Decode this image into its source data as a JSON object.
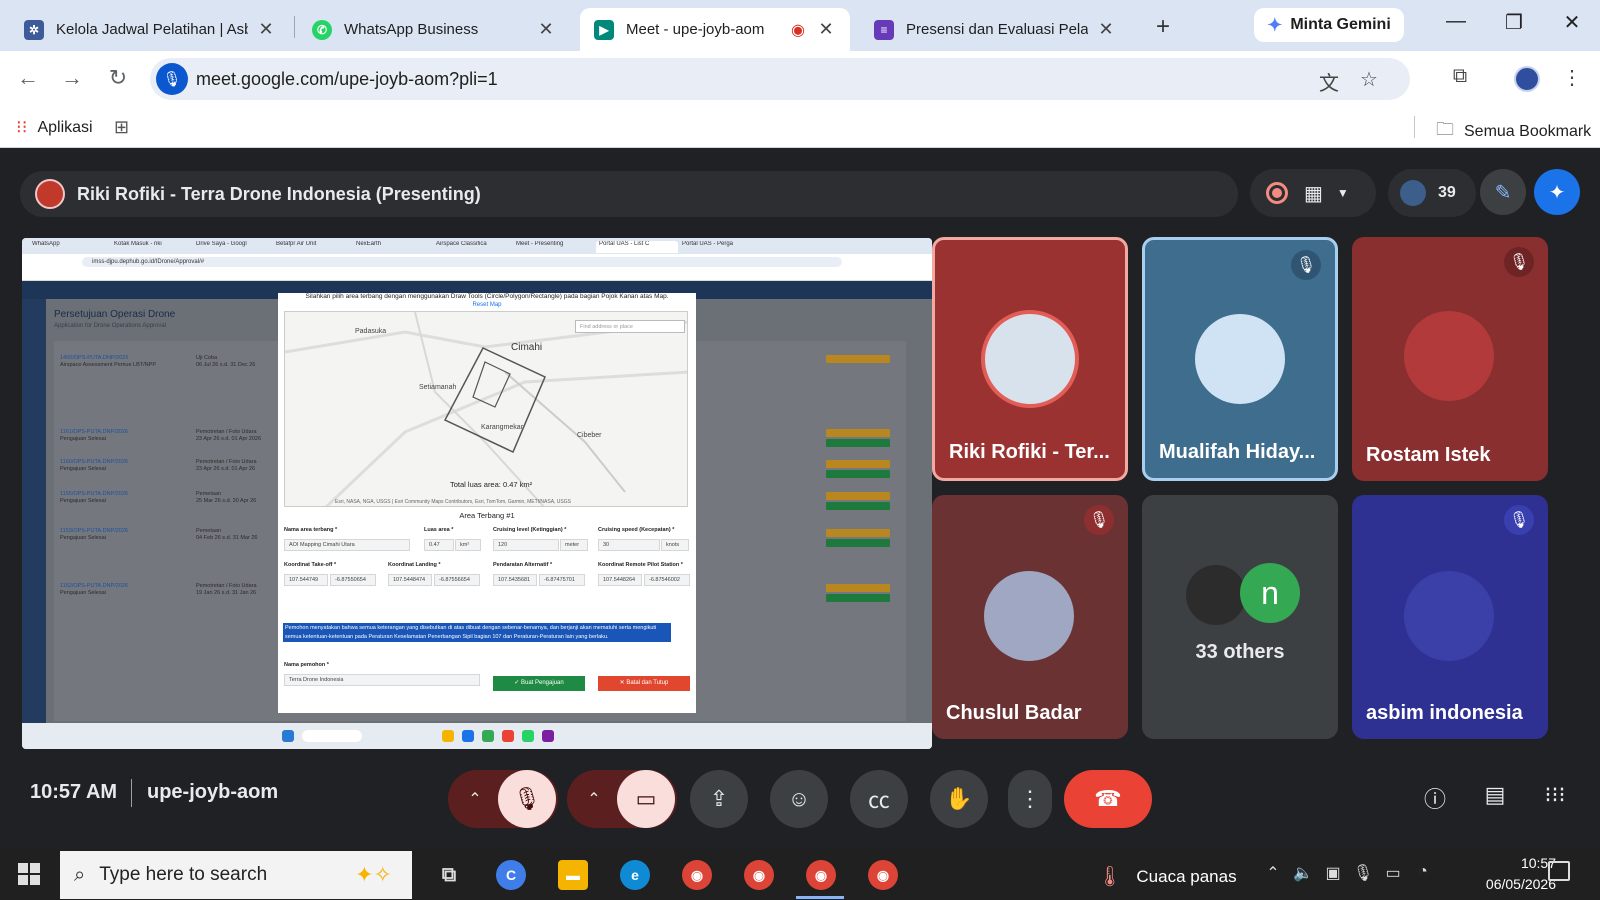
{
  "browser": {
    "tabs": [
      {
        "label": "Kelola Jadwal Pelatihan | Asbi",
        "icon": "asbim-icon",
        "color": "#3d5a99"
      },
      {
        "label": "WhatsApp Business",
        "icon": "whatsapp-icon",
        "color": "#25d366"
      },
      {
        "label": "Meet - upe-joyb-aom",
        "icon": "meet-icon",
        "color": "#00897b",
        "active": true
      },
      {
        "label": "Presensi dan Evaluasi Pelatiha",
        "icon": "forms-icon",
        "color": "#673ab7"
      }
    ],
    "gemini_label": "Minta Gemini",
    "url": "meet.google.com/upe-joyb-aom?pli=1",
    "bookmarks": {
      "apps": "Aplikasi",
      "all": "Semua Bookmark"
    }
  },
  "meet": {
    "presenter_label": "Riki Rofiki - Terra Drone Indonesia (Presenting)",
    "participant_count": "39",
    "participants": [
      {
        "name": "Riki Rofiki - Ter...",
        "muted": false,
        "bg": "#9b3232"
      },
      {
        "name": "Mualifah Hiday...",
        "muted": true,
        "bg": "#3f6d8e"
      },
      {
        "name": "Rostam Istek",
        "muted": true,
        "bg": "#8a2f2f"
      },
      {
        "name": "Chuslul Badar",
        "muted": true,
        "bg": "#6b3234"
      },
      {
        "name": "33 others",
        "muted": false,
        "bg": "#3c4043"
      },
      {
        "name": "asbim indonesia",
        "muted": true,
        "bg": "#2e3192"
      }
    ],
    "others_initial": "n",
    "time": "10:57 AM",
    "meeting_code": "upe-joyb-aom"
  },
  "shared_screen": {
    "url": "imss-djpu.dephub.go.id/IDrone/Approval/#",
    "tabs": [
      "WhatsApp",
      "Kotak Masuk - riki",
      "Drive Saya - Googl",
      "Betafpr Air Unit",
      "NexEarth",
      "Airspace Classifica",
      "Meet - Presenting",
      "Portal UAS - List C",
      "Portal UAS - Perga"
    ],
    "page_title": "Persetujuan Operasi Drone",
    "page_subtitle": "Application for Drone Operations Approval",
    "rows": [
      {
        "id": "1450/OPS-PUTA.DNP/2026",
        "sub": "Airspace Assessment Pemue LBT/NPP",
        "purpose": "Uji Coba",
        "date": "06 Jul 26 s.d. 31 Dec 26"
      },
      {
        "id": "1161/OPS-PUTA.DNP/2026",
        "sub": "Pengajuan Selesai",
        "purpose": "Pemotretan / Foto Udara",
        "date": "23 Apr 26 s.d. 01 Apr 2026"
      },
      {
        "id": "1160/OPS-PUTA.DNP/2026",
        "sub": "Pengajuan Selesai",
        "purpose": "Pemotretan / Foto Udara",
        "date": "23 Apr 26 s.d. 01 Apr 26"
      },
      {
        "id": "1155/OPS-PUTA.DNP/2026",
        "sub": "Pengajuan Selesai",
        "purpose": "Pemetaan",
        "date": "25 Mar 26 s.d. 30 Apr 26"
      },
      {
        "id": "1153/OPS-PUTA.DNP/2026",
        "sub": "Pengajuan Selesai",
        "purpose": "Pemetaan",
        "date": "04 Feb 26 s.d. 31 Mar 26"
      },
      {
        "id": "1152/OPS-PUTA.DNP/2026",
        "sub": "Pengajuan Selesai",
        "purpose": "Pemotretan / Foto Udara",
        "date": "19 Jan 26 s.d. 31 Jan 26"
      }
    ],
    "modal": {
      "instruction": "Silahkan pilih area terbang dengan menggunakan Draw Tools (Circle/Polygon/Rectangle) pada bagian Pojok Kanan atas Map.",
      "reset": "Reset Map",
      "map_labels": [
        "Padasuka",
        "Cimahi",
        "Setiamanah",
        "Karangmekar",
        "Cibeber"
      ],
      "search_placeholder": "Find address or place",
      "total_area": "Total luas area: 0.47 km²",
      "attribution": "Esri, NASA, NGA, USGS | Esri Community Maps Contributors, Esri, TomTom, Garmin, METI/NASA, USGS",
      "area_title": "Area Terbang #1",
      "fields": [
        {
          "label": "Nama area terbang *",
          "value": "AOI Mapping Cimahi Utara"
        },
        {
          "label": "Luas area *",
          "value": "0.47"
        },
        {
          "label": "Cruising level (Ketinggian) *",
          "value": "120"
        },
        {
          "label": "Cruising speed (Kecepatan) *",
          "value": "30"
        }
      ],
      "units": [
        "km²",
        "meter",
        "knots"
      ],
      "coords": [
        {
          "label": "Koordinat Take-off *",
          "a": "107.544749",
          "b": "-6.87550654"
        },
        {
          "label": "Koordinat Landing *",
          "a": "107.5448474",
          "b": "-6.87556654"
        },
        {
          "label": "Pendaratan Alternatif *",
          "a": "107.5435681",
          "b": "-6.87475701"
        },
        {
          "label": "Koordinat Remote Pilot Station *",
          "a": "107.5448264",
          "b": "-6.87546002"
        }
      ],
      "declaration": "Pemohon menyatakan bahwa semua keterangan yang disebutkan di atas dibuat dengan sebenar-benarnya, dan berjanji akan mematuhi serta mengikuti semua ketentuan-ketentuan pada Peraturan Keselamatan Penerbangan Sipil bagian 107 dan Peraturan-Peraturan lain yang berlaku.",
      "applicant_label": "Nama pemohon *",
      "applicant_value": "Terra Drone Indonesia",
      "submit": "✓ Buat Pengajuan",
      "cancel": "✕ Batal dan Tutup"
    }
  },
  "taskbar": {
    "search_placeholder": "Type here to search",
    "weather": "Cuaca panas",
    "time": "10:57",
    "date": "06/05/2026"
  }
}
